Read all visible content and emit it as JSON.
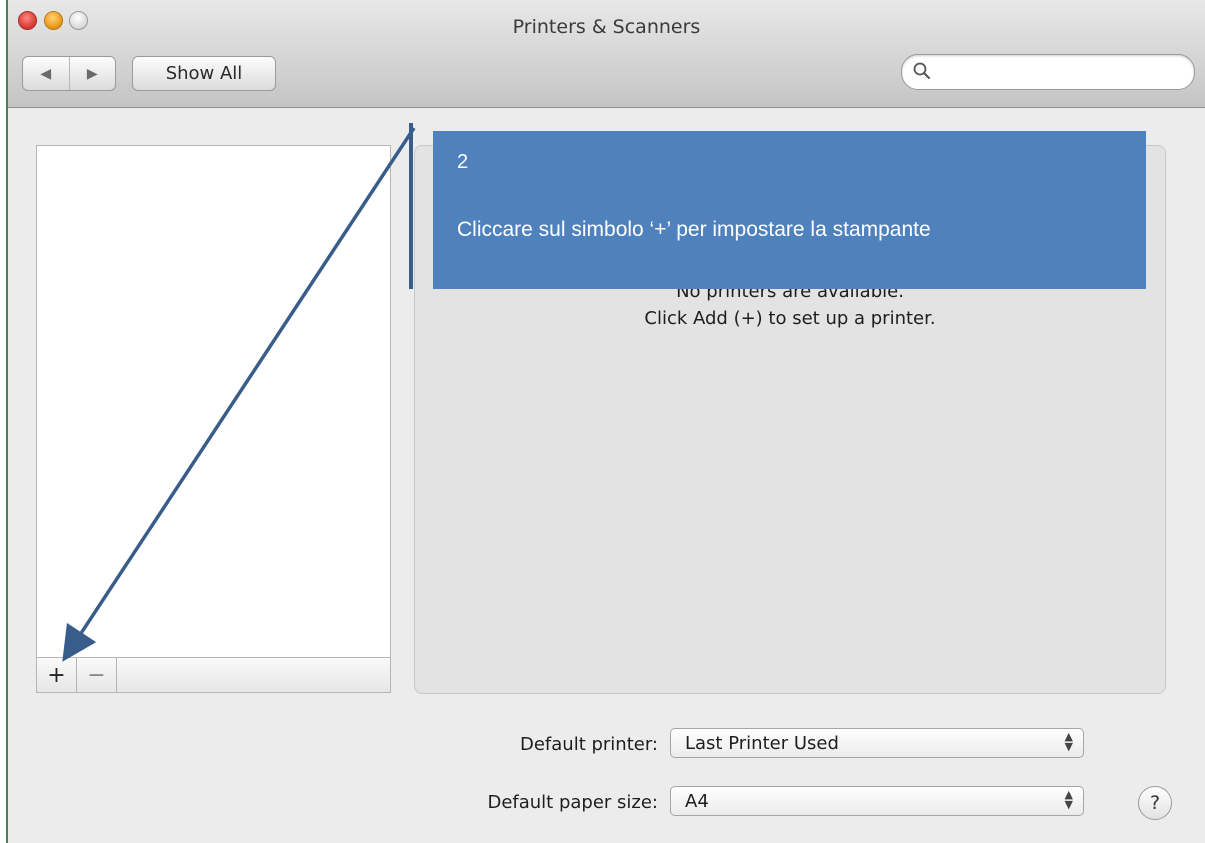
{
  "window": {
    "title": "Printers & Scanners"
  },
  "toolbar": {
    "back_icon": "◀",
    "forward_icon": "▶",
    "show_all_label": "Show All",
    "search_placeholder": "",
    "search_value": ""
  },
  "printer_list": {
    "add_label": "+",
    "remove_label": "−"
  },
  "detail": {
    "empty_line1": "No printers are available.",
    "empty_line2": "Click Add (+) to set up a printer."
  },
  "callout": {
    "step": "2",
    "text": "Cliccare sul simbolo ‘+’ per  impostare la stampante",
    "color": "#4f81bd",
    "arrow_color": "#385d8a"
  },
  "preferences": {
    "default_printer_label": "Default printer:",
    "default_printer_value": "Last Printer Used",
    "default_paper_label": "Default paper size:",
    "default_paper_value": "A4"
  },
  "help": {
    "label": "?"
  }
}
